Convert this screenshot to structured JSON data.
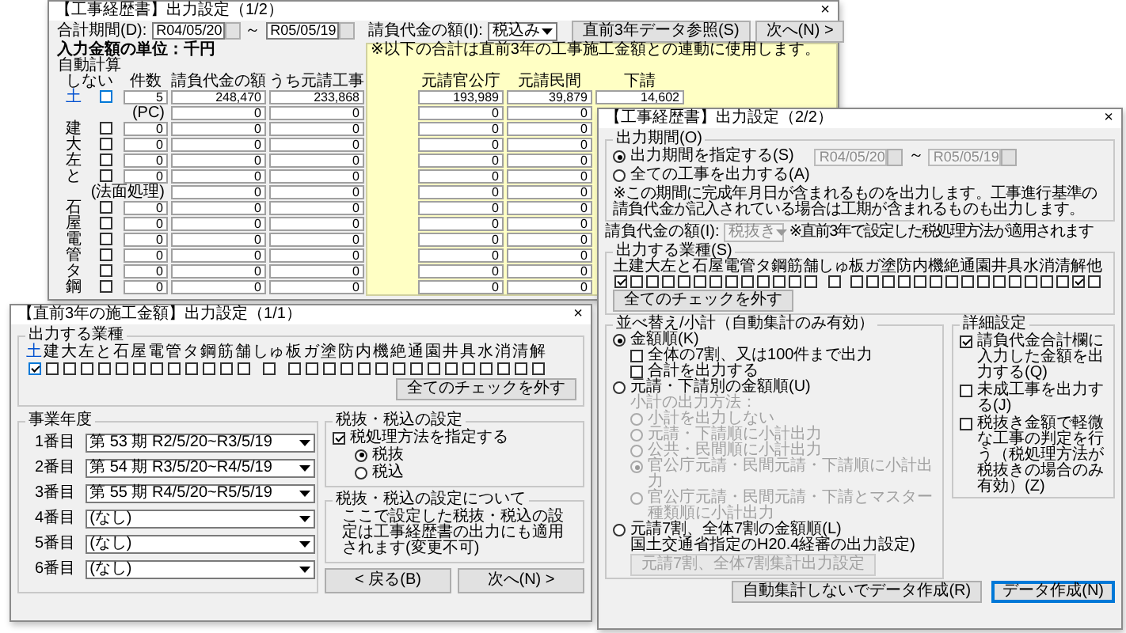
{
  "summary_window": {
    "title": "【工事経歴書】出力設定（1/2）",
    "close": "×",
    "period": {
      "label": "合計期間(D):",
      "from": "R04/05/20",
      "separator": "～",
      "to": "R05/05/19"
    },
    "amount": {
      "label": "請負代金の額(I):",
      "value": "税込み"
    },
    "buttons": [
      "直前3年データ参照(S)",
      "次へ(N) >"
    ],
    "unit": "入力金額の単位：千円",
    "note": "※以下の合計は直前3年の工事施工金額との連動に使用します。",
    "auto_header": "自動計算しない",
    "columns": [
      "件数",
      "請負代金の額",
      "うち元請工事",
      "元請官公庁",
      "元請民間",
      "下請"
    ],
    "rows": [
      {
        "kind": "industry",
        "label": "土",
        "checked": false,
        "focused": true,
        "cells": [
          "5",
          "248,470",
          "233,868",
          "193,989",
          "39,879",
          "14,602"
        ]
      },
      {
        "kind": "subtotal",
        "label": "(PC)",
        "cells": [
          "",
          "0",
          "0",
          "0",
          "0"
        ]
      },
      {
        "kind": "industry",
        "label": "建",
        "checked": false,
        "focused": false,
        "cells": [
          "0",
          "0",
          "0",
          "0",
          "0"
        ]
      },
      {
        "kind": "industry",
        "label": "大",
        "checked": false,
        "focused": false,
        "cells": [
          "0",
          "0",
          "0",
          "0",
          "0"
        ]
      },
      {
        "kind": "industry",
        "label": "左",
        "checked": false,
        "focused": false,
        "cells": [
          "0",
          "0",
          "0",
          "0",
          "0"
        ]
      },
      {
        "kind": "industry",
        "label": "と",
        "checked": false,
        "focused": false,
        "cells": [
          "0",
          "0",
          "0",
          "0",
          "0"
        ]
      },
      {
        "kind": "subtotal",
        "label": "(法面処理)",
        "cells": [
          "",
          "0",
          "0",
          "0",
          "0"
        ]
      },
      {
        "kind": "industry",
        "label": "石",
        "checked": false,
        "focused": false,
        "cells": [
          "0",
          "0",
          "0",
          "0",
          "0"
        ]
      },
      {
        "kind": "industry",
        "label": "屋",
        "checked": false,
        "focused": false,
        "cells": [
          "0",
          "0",
          "0",
          "0",
          "0"
        ]
      },
      {
        "kind": "industry",
        "label": "電",
        "checked": false,
        "focused": false,
        "cells": [
          "0",
          "0",
          "0",
          "0",
          "0"
        ]
      },
      {
        "kind": "industry",
        "label": "管",
        "checked": false,
        "focused": false,
        "cells": [
          "0",
          "0",
          "0",
          "0",
          "0"
        ]
      },
      {
        "kind": "industry",
        "label": "タ",
        "checked": false,
        "focused": false,
        "cells": [
          "0",
          "0",
          "0",
          "0",
          "0"
        ]
      },
      {
        "kind": "industry",
        "label": "鋼",
        "checked": false,
        "focused": false,
        "cells": [
          "0",
          "0",
          "0",
          "0",
          "0"
        ]
      }
    ]
  },
  "options_window": {
    "title": "【工事経歴書】出力設定（2/2）",
    "close": "×",
    "period": {
      "legend": "出力期間(O)",
      "options": [
        {
          "label": "出力期間を指定する(S)",
          "selected": true
        },
        {
          "label": "全ての工事を出力する(A)",
          "selected": false
        }
      ],
      "from": "R04/05/20",
      "separator": "～",
      "to": "R05/05/19",
      "dates_disabled": true,
      "note": "※この期間に完成年月日が含まれるものを出力します。工事進行基準の請負代金が記入されている場合は工期が含まれるものも出力します。"
    },
    "amount": {
      "label": "請負代金の額(I):",
      "value": "税抜き",
      "disabled": true,
      "note": "※直前3年で設定した税処理方法が適用されます"
    },
    "industries": {
      "legend": "出力する業種(S)",
      "button": "全てのチェックを外す",
      "items": [
        {
          "label": "土",
          "checked": true
        },
        {
          "label": "建",
          "checked": false
        },
        {
          "label": "大",
          "checked": false
        },
        {
          "label": "左",
          "checked": false
        },
        {
          "label": "と",
          "checked": false
        },
        {
          "label": "石",
          "checked": false
        },
        {
          "label": "屋",
          "checked": false
        },
        {
          "label": "電",
          "checked": false
        },
        {
          "label": "管",
          "checked": false
        },
        {
          "label": "タ",
          "checked": false
        },
        {
          "label": "鋼",
          "checked": false
        },
        {
          "label": "筋",
          "checked": false
        },
        {
          "label": "舗",
          "checked": false
        },
        {
          "label": "しゅ",
          "checked": false
        },
        {
          "label": "板",
          "checked": false
        },
        {
          "label": "ガ",
          "checked": false
        },
        {
          "label": "塗",
          "checked": false
        },
        {
          "label": "防",
          "checked": false
        },
        {
          "label": "内",
          "checked": false
        },
        {
          "label": "機",
          "checked": false
        },
        {
          "label": "絶",
          "checked": false
        },
        {
          "label": "通",
          "checked": false
        },
        {
          "label": "園",
          "checked": false
        },
        {
          "label": "井",
          "checked": false
        },
        {
          "label": "具",
          "checked": false
        },
        {
          "label": "水",
          "checked": false
        },
        {
          "label": "消",
          "checked": false
        },
        {
          "label": "清",
          "checked": false
        },
        {
          "label": "解",
          "checked": true
        },
        {
          "label": "他",
          "checked": false
        }
      ]
    },
    "sorting": {
      "legend": "並べ替え/小計（自動集計のみ有効）",
      "items": [
        {
          "kind": "radio",
          "label": "金額順(K)",
          "selected": true,
          "disabled": false,
          "children": [
            {
              "kind": "checkbox",
              "label": "全体の7割、又は100件まで出力",
              "checked": false,
              "disabled": false
            },
            {
              "kind": "checkbox",
              "label": "合計を出力する",
              "checked": false,
              "disabled": false
            }
          ]
        },
        {
          "kind": "radio",
          "label": "元請・下請別の金額順(U)",
          "selected": false,
          "disabled": false,
          "children": [
            {
              "kind": "text",
              "label": "小計の出力方法：",
              "disabled": true
            },
            {
              "kind": "radio",
              "label": "小計を出力しない",
              "selected": false,
              "disabled": true
            },
            {
              "kind": "radio",
              "label": "元請・下請順に小計出力",
              "selected": false,
              "disabled": true
            },
            {
              "kind": "radio",
              "label": "公共・民間順に小計出力",
              "selected": false,
              "disabled": true
            },
            {
              "kind": "radio",
              "label": "官公庁元請・民間元請・下請順に小計出力",
              "selected": true,
              "disabled": true
            },
            {
              "kind": "radio",
              "label": "官公庁元請・民間元請・下請とマスター種類順に小計出力",
              "selected": false,
              "disabled": true
            }
          ]
        },
        {
          "kind": "radio",
          "label": "元請7割、全体7割の金額順(L)",
          "selected": false,
          "disabled": false,
          "children": [
            {
              "kind": "text",
              "label": "国土交通省指定のH20.4経審の出力設定)",
              "disabled": false
            },
            {
              "kind": "button",
              "label": "元請7割、全体7割集計出力設定",
              "disabled": true
            }
          ]
        }
      ]
    },
    "details": {
      "legend": "詳細設定",
      "items": [
        {
          "label": "請負代金合計欄に入力した金額を出力する(Q)",
          "checked": true
        },
        {
          "label": "未成工事を出力する(J)",
          "checked": false
        },
        {
          "label": "税抜き金額で軽微な工事の判定を行う（税処理方法が税抜きの場合のみ有効）(Z)",
          "checked": false
        }
      ]
    },
    "buttons": [
      {
        "label": "自動集計しないでデータ作成(R)",
        "default": false
      },
      {
        "label": "データ作成(N)",
        "default": true
      }
    ]
  },
  "prior_years_window": {
    "title": "【直前3年の施工金額】出力設定（1/1）",
    "close": "×",
    "industries": {
      "legend": "出力する業種",
      "button": "全てのチェックを外す",
      "items": [
        {
          "label": "土",
          "checked": true,
          "focused": true
        },
        {
          "label": "建",
          "checked": false,
          "focused": false
        },
        {
          "label": "大",
          "checked": false,
          "focused": false
        },
        {
          "label": "左",
          "checked": false,
          "focused": false
        },
        {
          "label": "と",
          "checked": false,
          "focused": false
        },
        {
          "label": "石",
          "checked": false,
          "focused": false
        },
        {
          "label": "屋",
          "checked": false,
          "focused": false
        },
        {
          "label": "電",
          "checked": false,
          "focused": false
        },
        {
          "label": "管",
          "checked": false,
          "focused": false
        },
        {
          "label": "タ",
          "checked": false,
          "focused": false
        },
        {
          "label": "鋼",
          "checked": false,
          "focused": false
        },
        {
          "label": "筋",
          "checked": false,
          "focused": false
        },
        {
          "label": "舗",
          "checked": false,
          "focused": false
        },
        {
          "label": "しゅ",
          "checked": false,
          "focused": false
        },
        {
          "label": "板",
          "checked": false,
          "focused": false
        },
        {
          "label": "ガ",
          "checked": false,
          "focused": false
        },
        {
          "label": "塗",
          "checked": false,
          "focused": false
        },
        {
          "label": "防",
          "checked": false,
          "focused": false
        },
        {
          "label": "内",
          "checked": false,
          "focused": false
        },
        {
          "label": "機",
          "checked": false,
          "focused": false
        },
        {
          "label": "絶",
          "checked": false,
          "focused": false
        },
        {
          "label": "通",
          "checked": false,
          "focused": false
        },
        {
          "label": "園",
          "checked": false,
          "focused": false
        },
        {
          "label": "井",
          "checked": false,
          "focused": false
        },
        {
          "label": "具",
          "checked": false,
          "focused": false
        },
        {
          "label": "水",
          "checked": false,
          "focused": false
        },
        {
          "label": "消",
          "checked": false,
          "focused": false
        },
        {
          "label": "清",
          "checked": false,
          "focused": false
        },
        {
          "label": "解",
          "checked": false,
          "focused": false
        }
      ]
    },
    "fiscal_years": {
      "legend": "事業年度",
      "rows": [
        {
          "label": "1番目",
          "value": "第 53 期 R2/5/20~R3/5/19"
        },
        {
          "label": "2番目",
          "value": "第 54 期 R3/5/20~R4/5/19"
        },
        {
          "label": "3番目",
          "value": "第 55 期 R4/5/20~R5/5/19"
        },
        {
          "label": "4番目",
          "value": "(なし)"
        },
        {
          "label": "5番目",
          "value": "(なし)"
        },
        {
          "label": "6番目",
          "value": "(なし)"
        }
      ]
    },
    "tax": {
      "legend": "税抜・税込の設定",
      "checkbox": {
        "label": "税処理方法を指定する",
        "checked": true
      },
      "options": [
        {
          "label": "税抜",
          "selected": true
        },
        {
          "label": "税込",
          "selected": false
        }
      ]
    },
    "tax_note": {
      "legend": "税抜・税込の設定について",
      "text": "ここで設定した税抜・税込の設定は工事経歴書の出力にも適用されます(変更不可)"
    },
    "buttons": [
      "< 戻る(B)",
      "次へ(N) >"
    ]
  }
}
